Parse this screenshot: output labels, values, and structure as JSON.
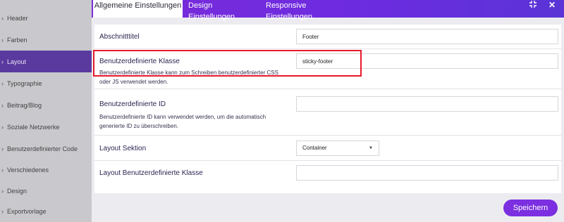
{
  "sidebar": {
    "items": [
      {
        "label": "Header",
        "icon": "header-icon"
      },
      {
        "label": "Farben",
        "icon": "palette-icon"
      },
      {
        "label": "Layout",
        "icon": "layout-icon",
        "active": true
      },
      {
        "label": "Typographie",
        "icon": "typography-icon"
      },
      {
        "label": "Beitrag/Blog",
        "icon": "blog-icon"
      },
      {
        "label": "Soziale Netzwerke",
        "icon": "share-icon"
      },
      {
        "label": "Benutzerdefinierter Code",
        "icon": "code-icon"
      },
      {
        "label": "Verschiedenes",
        "icon": "misc-icon"
      },
      {
        "label": "Design",
        "icon": "design-icon"
      },
      {
        "label": "Exportvorlage",
        "icon": "export-icon"
      }
    ]
  },
  "modal": {
    "tabs": [
      {
        "label": "Allgemeine Einstellungen",
        "active": true
      },
      {
        "label": "Design Einstellungen"
      },
      {
        "label": "Responsive Einstellungen"
      }
    ],
    "collapse_icon": "compress-icon",
    "close_icon": "close-icon",
    "fields": {
      "section_title": {
        "label": "Abschnitttitel",
        "value": "Footer"
      },
      "custom_class": {
        "label": "Benutzerdefinierte Klasse",
        "value": "sticky-footer",
        "help": "Benutzerdefinierte Klasse kann zum Schreiben benutzerdefinierter CSS oder JS verwendet werden."
      },
      "custom_id": {
        "label": "Benutzerdefinierte ID",
        "value": "",
        "help": "Benutzerdefinierte ID kann verwendet werden, um die automatisch generierte ID zu überschreiben."
      },
      "layout_section": {
        "label": "Layout Sektion",
        "value": "Container"
      },
      "layout_custom_class": {
        "label": "Layout Benutzerdefinierte Klasse",
        "value": ""
      }
    },
    "save_label": "Speichern"
  },
  "colors": {
    "accent": "#7b2fe0",
    "highlight": "#e8192c",
    "sidebar_active": "#5b3aa0"
  }
}
